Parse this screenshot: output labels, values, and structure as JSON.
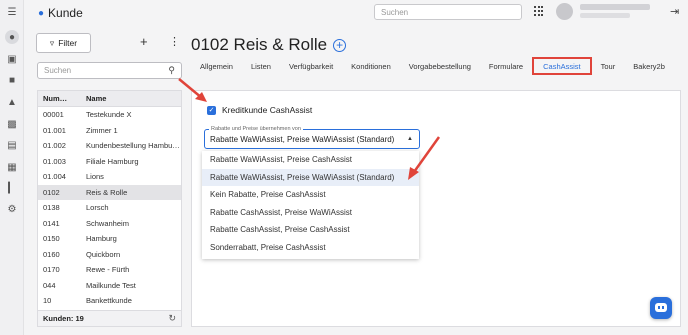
{
  "app": {
    "title": "Kunde"
  },
  "topbar": {
    "search_placeholder": "Suchen"
  },
  "sidebar": {
    "icons": [
      "menu-icon",
      "person-icon",
      "scan-icon",
      "briefcase-icon",
      "cart-icon",
      "print-icon",
      "document-icon",
      "clipboard-icon",
      "chart-icon",
      "settings-icon"
    ]
  },
  "left": {
    "filter_label": "Filter",
    "search_placeholder": "Suchen",
    "columns": [
      "Num…",
      "Name"
    ],
    "rows": [
      {
        "num": "00001",
        "name": "Testekunde X"
      },
      {
        "num": "01.001",
        "name": "Zimmer 1"
      },
      {
        "num": "01.002",
        "name": "Kundenbestellung Hambu…"
      },
      {
        "num": "01.003",
        "name": "Filiale Hamburg"
      },
      {
        "num": "01.004",
        "name": "Lions"
      },
      {
        "num": "0102",
        "name": "Reis & Rolle"
      },
      {
        "num": "0138",
        "name": "Lorsch"
      },
      {
        "num": "0141",
        "name": "Schwanheim"
      },
      {
        "num": "0150",
        "name": "Hamburg"
      },
      {
        "num": "0160",
        "name": "Quickborn"
      },
      {
        "num": "0170",
        "name": "Rewe - Fürth"
      },
      {
        "num": "044",
        "name": "Mailkunde Test"
      },
      {
        "num": "10",
        "name": "Bankettkunde"
      }
    ],
    "footer": "Kunden: 19"
  },
  "detail": {
    "title": "0102 Reis & Rolle",
    "tabs": [
      "Allgemein",
      "Listen",
      "Verfügbarkeit",
      "Konditionen",
      "Vorgabebestellung",
      "Formulare",
      "CashAssist",
      "Tour",
      "Bakery2b"
    ],
    "checkbox_label": "Kreditkunde CashAssist",
    "select_label": "Rabatte und Preise übernehmen von",
    "select_value": "Rabatte WaWiAssist, Preise WaWiAssist (Standard)",
    "options": [
      "Rabatte WaWiAssist, Preise CashAssist",
      "Rabatte WaWiAssist, Preise WaWiAssist (Standard)",
      "Kein Rabatte, Preise CashAssist",
      "Rabatte CashAssist, Preise WaWiAssist",
      "Rabatte CashAssist, Preise CashAssist",
      "Sonderrabatt, Preise CashAssist"
    ]
  },
  "colors": {
    "accent": "#2a6fdb",
    "highlight": "#e0443a"
  }
}
